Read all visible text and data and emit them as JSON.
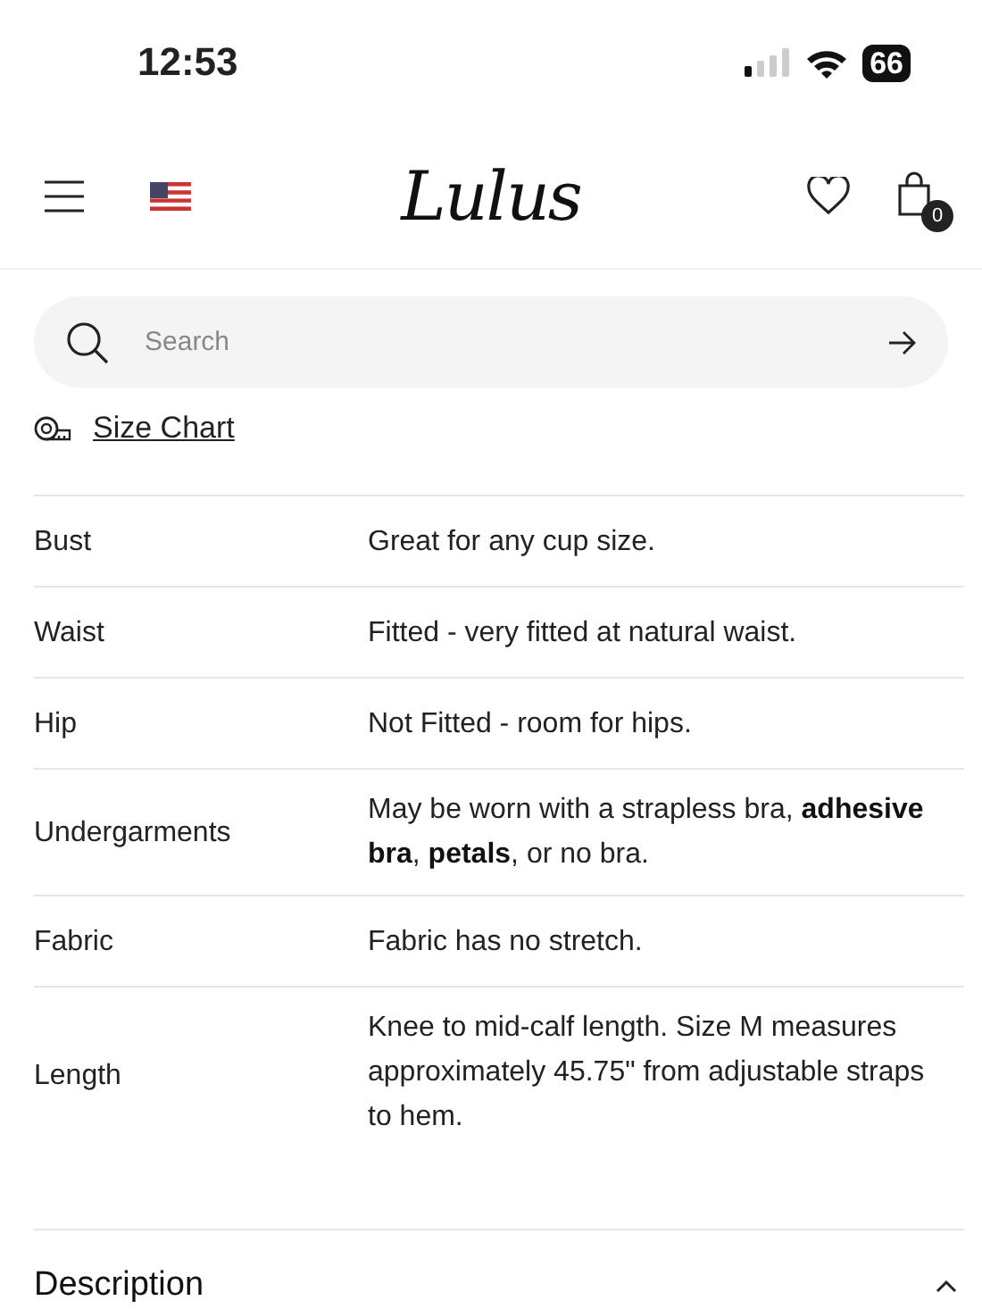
{
  "status_bar": {
    "time": "12:53",
    "battery": "66"
  },
  "header": {
    "logo": "Lulus",
    "cart_count": "0"
  },
  "search": {
    "placeholder": "Search"
  },
  "size_chart_link": "Size Chart",
  "fit_table": {
    "rows": [
      {
        "label": "Bust",
        "value": "Great for any cup size."
      },
      {
        "label": "Waist",
        "value": "Fitted - very fitted at natural waist."
      },
      {
        "label": "Hip",
        "value": "Not Fitted - room for hips."
      },
      {
        "label": "Undergarments",
        "value": "May be worn with a strapless bra, **adhesive bra**, **petals**, or no bra."
      },
      {
        "label": "Fabric",
        "value": "Fabric has no stretch."
      },
      {
        "label": "Length",
        "value": "Knee to mid-calf length. Size M measures approximately 45.75\" from adjustable straps to hem."
      }
    ]
  },
  "section": {
    "title": "Description",
    "expanded": true
  }
}
